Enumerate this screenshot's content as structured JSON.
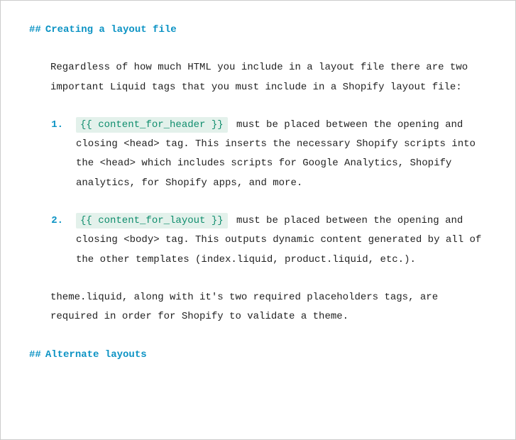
{
  "heading1": {
    "hashes": "##",
    "text": "Creating a layout file"
  },
  "intro": "Regardless of how much HTML you include in a layout file there are two important Liquid tags that you must include in a Shopify layout file:",
  "items": [
    {
      "marker": "1.",
      "code": "{{ content_for_header }}",
      "rest": " must be placed between the opening and closing <head> tag. This inserts the necessary Shopify scripts into the <head> which includes scripts for Google Analytics, Shopify analytics, for Shopify apps, and more."
    },
    {
      "marker": "2.",
      "code": "{{ content_for_layout }}",
      "rest": " must be placed between the opening and closing <body> tag. This outputs dynamic content generated by all of the other templates (index.liquid, product.liquid, etc.)."
    }
  ],
  "outro": "theme.liquid, along with it's two required placeholders tags, are required in order for Shopify to validate a theme.",
  "heading2": {
    "hashes": "##",
    "text": "Alternate layouts"
  }
}
